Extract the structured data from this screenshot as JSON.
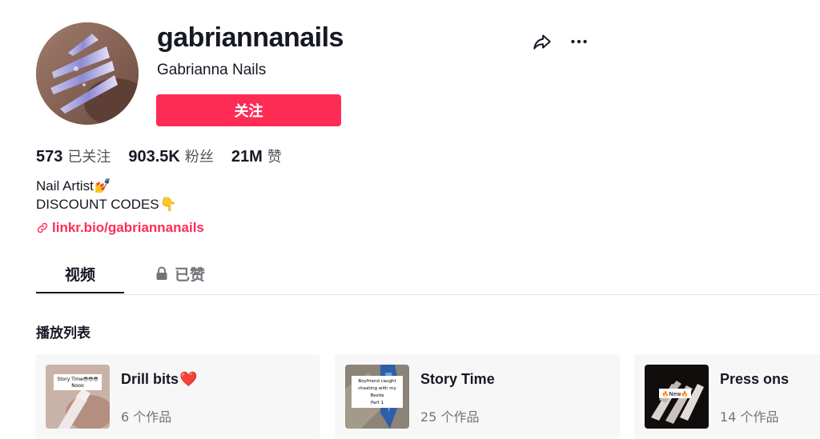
{
  "profile": {
    "username": "gabriannanails",
    "nickname": "Gabrianna Nails",
    "follow_label": "关注",
    "avatar_icon": "nail-art-photo"
  },
  "actions": {
    "share_icon": "share-icon",
    "more_icon": "more-icon"
  },
  "stats": {
    "following_count": "573",
    "following_label": "已关注",
    "followers_count": "903.5K",
    "followers_label": "粉丝",
    "likes_count": "21M",
    "likes_label": "赞"
  },
  "bio": {
    "line1": "Nail Artist",
    "line1_emoji": "💅",
    "line2": "DISCOUNT CODES",
    "line2_emoji": "👇"
  },
  "link": {
    "text": "linkr.bio/gabriannanails",
    "icon": "link-icon"
  },
  "tabs": [
    {
      "label": "视频",
      "active": true
    },
    {
      "label": "已赞",
      "active": false,
      "icon": "lock-icon"
    }
  ],
  "playlists_section": {
    "title": "播放列表",
    "items": [
      {
        "name": "Drill bits",
        "name_emoji": "❤️",
        "count": "6 个作品",
        "thumb_caption_line1": "Story Time😳😳😳",
        "thumb_caption_line2": "Nooo"
      },
      {
        "name": "Story Time",
        "count": "25 个作品",
        "thumb_caption_line1": "Boyfriend caught",
        "thumb_caption_line2": "cheating with my",
        "thumb_caption_line3": "Bestie",
        "thumb_caption_line4": "Part 1"
      },
      {
        "name": "Press ons",
        "count": "14 个作品",
        "thumb_caption_line1": "🔥New🔥"
      }
    ]
  },
  "colors": {
    "accent": "#fe2c55",
    "text": "#161823",
    "card_bg": "#f7f7f8",
    "divider": "#e3e3e4"
  }
}
